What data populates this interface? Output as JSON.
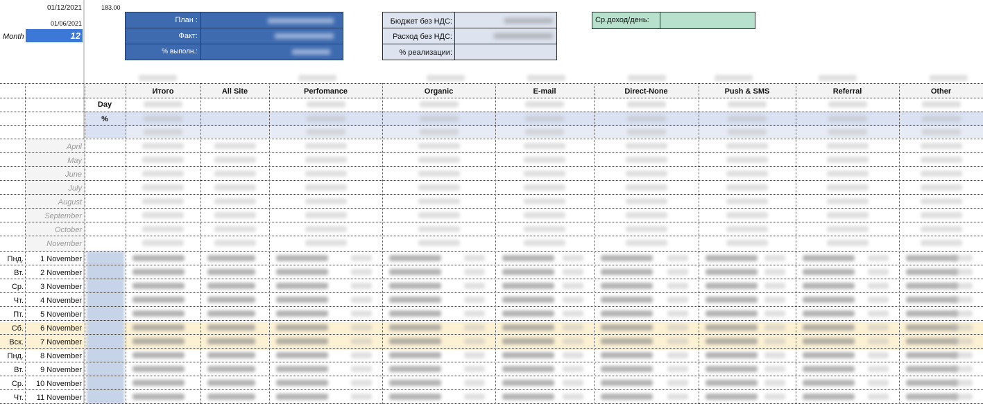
{
  "top": {
    "date1": "01/12/2021",
    "date2": "01/06/2021",
    "month_label": "Month",
    "month_value": "12",
    "days_value": "183.00"
  },
  "plan_box": {
    "plan_label": "План :",
    "fact_label": "Факт:",
    "pct_label": "% выполн.:"
  },
  "budget_box": {
    "budget_label": "Бюджет без НДС:",
    "expense_label": "Расход без НДС:",
    "realization_label": "% реализации:"
  },
  "avg_box": {
    "label": "Ср.доход/день:"
  },
  "table": {
    "columns": [
      "Итого",
      "All Site",
      "Perfomance",
      "Organic",
      "E-mail",
      "Direct-None",
      "Push & SMS",
      "Referral",
      "Other"
    ],
    "day_label": "Day",
    "pct_label": "%",
    "months": [
      "April",
      "May",
      "June",
      "July",
      "August",
      "September",
      "October",
      "November"
    ],
    "days": [
      {
        "weekday": "Пнд.",
        "date": "1 November"
      },
      {
        "weekday": "Вт.",
        "date": "2 November"
      },
      {
        "weekday": "Ср.",
        "date": "3 November"
      },
      {
        "weekday": "Чт.",
        "date": "4 November"
      },
      {
        "weekday": "Пт.",
        "date": "5 November"
      },
      {
        "weekday": "Сб.",
        "date": "6 November"
      },
      {
        "weekday": "Вск.",
        "date": "7 November"
      },
      {
        "weekday": "Пнд.",
        "date": "8 November"
      },
      {
        "weekday": "Вт.",
        "date": "9 November"
      },
      {
        "weekday": "Ср.",
        "date": "10 November"
      },
      {
        "weekday": "Чт.",
        "date": "11 November"
      }
    ]
  },
  "colors": {
    "plan_blue": "#3e6aaf",
    "budget_bg": "#dde3ef",
    "avg_green": "#b7e1cd",
    "weekend_bg": "#fdf1d3",
    "header_bg": "#f3f3f3",
    "pct_row_bg": "#d9e1f2",
    "month_cell_blue": "#3c78d8"
  }
}
